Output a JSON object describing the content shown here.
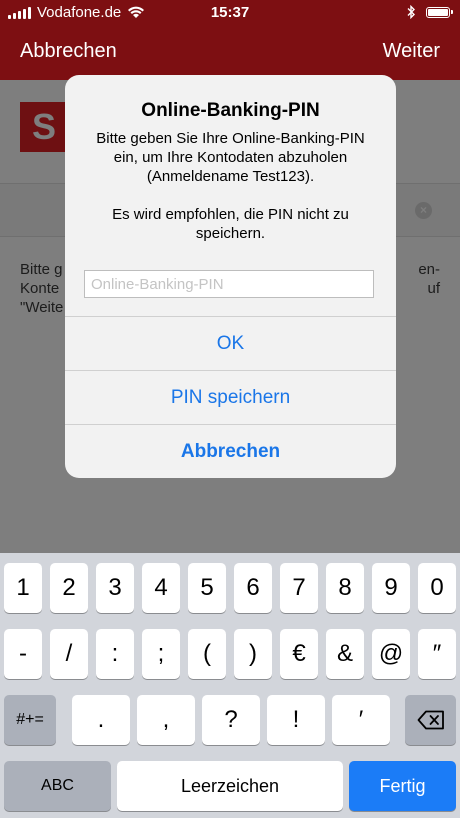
{
  "status_bar": {
    "carrier": "Vodafone.de",
    "time": "15:37",
    "wifi_icon": "wifi-icon",
    "bluetooth_icon": "bluetooth-icon",
    "battery_icon": "battery-icon"
  },
  "nav": {
    "left": "Abbrechen",
    "right": "Weiter"
  },
  "background": {
    "logo_text": "S",
    "search_clear_icon": "clear-icon",
    "text_lines": [
      "Bitte g",
      "Konte",
      "\"Weite"
    ],
    "text_right_lines": [
      "en-",
      "uf",
      ""
    ]
  },
  "dialog": {
    "title": "Online-Banking-PIN",
    "message": "Bitte geben Sie Ihre Online-Banking-PIN ein, um Ihre Kontodaten abzuholen (Anmeldename Test123).\n\nEs wird empfohlen, die PIN nicht zu speichern.",
    "input_placeholder": "Online-Banking-PIN",
    "input_value": "",
    "buttons": [
      "OK",
      "PIN speichern",
      "Abbrechen"
    ]
  },
  "keyboard": {
    "row1": [
      "1",
      "2",
      "3",
      "4",
      "5",
      "6",
      "7",
      "8",
      "9",
      "0"
    ],
    "row2": [
      "-",
      "/",
      ":",
      ";",
      "(",
      ")",
      "€",
      "&",
      "@",
      "″"
    ],
    "row3_left": "#+=",
    "row3": [
      ".",
      ",",
      "?",
      "!",
      "′"
    ],
    "backspace_icon": "backspace-icon",
    "abc": "ABC",
    "space": "Leerzeichen",
    "done": "Fertig",
    "colors": {
      "done_key": "#1b7cf7",
      "accent": "#1a76e8",
      "brand": "#7d0f12"
    }
  }
}
